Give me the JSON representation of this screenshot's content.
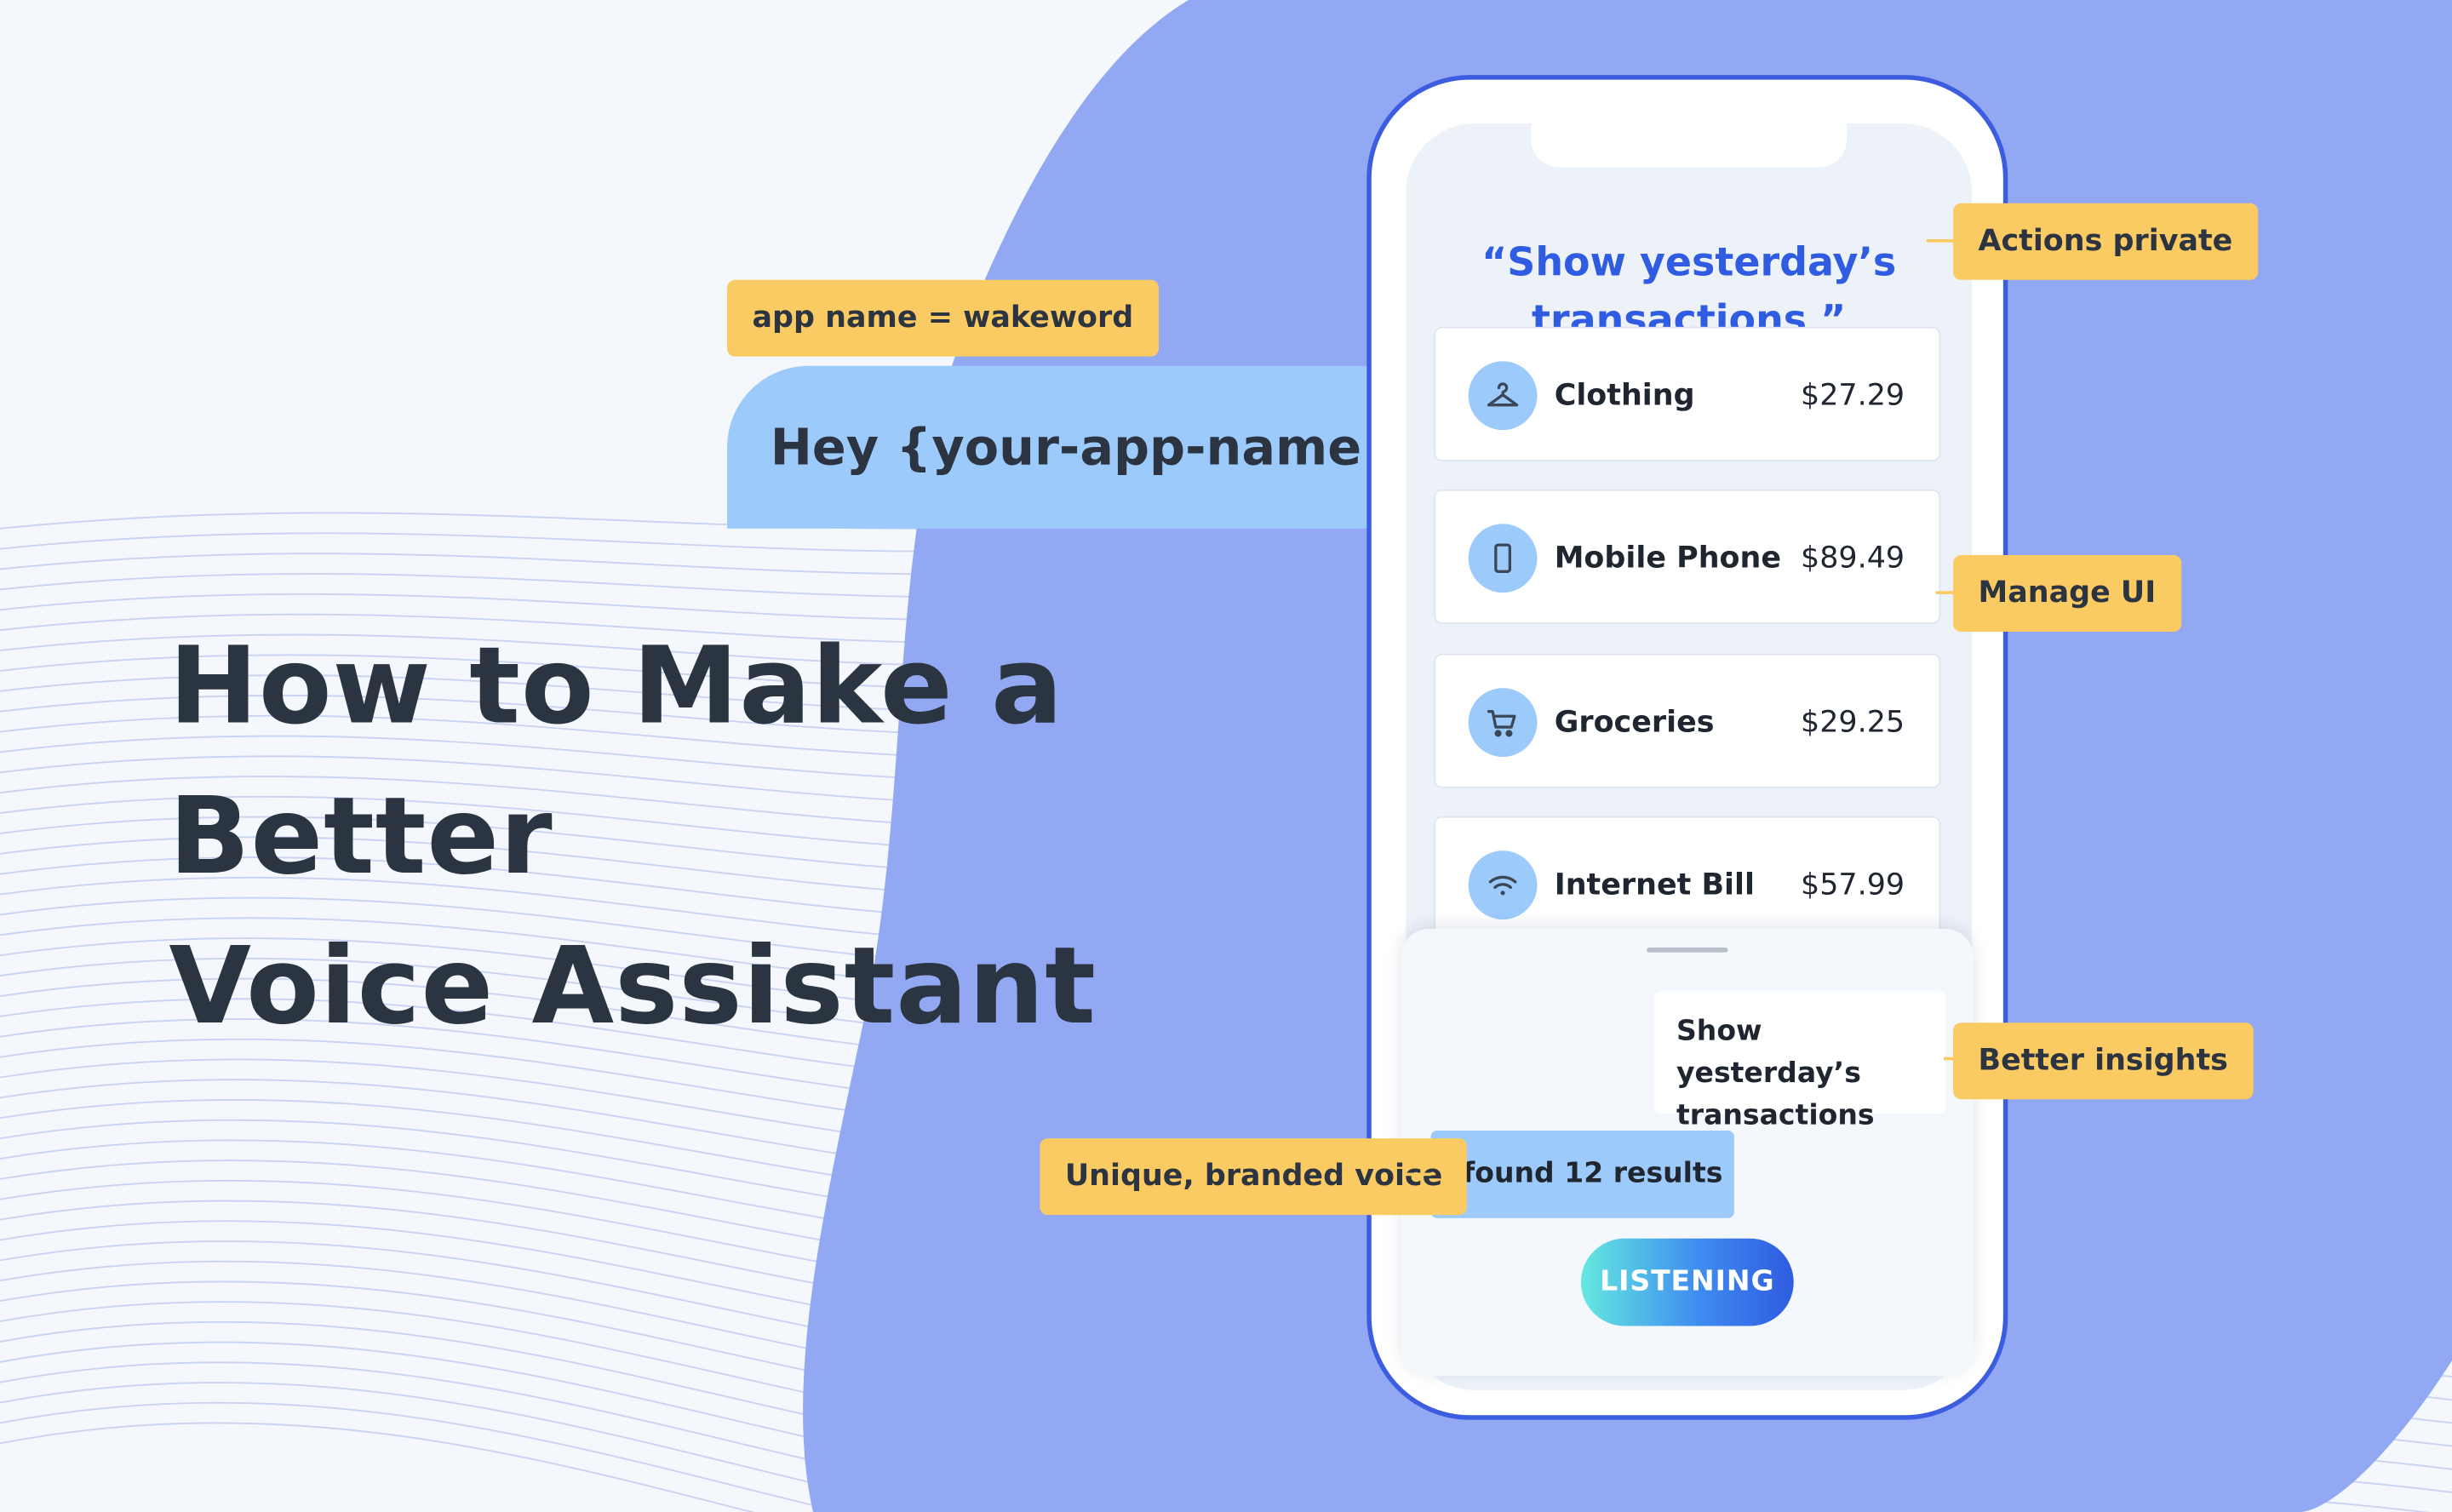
{
  "headline": {
    "line1": "How to Make a Better",
    "line2": "Voice Assistant"
  },
  "wakeword_tag": "app name = wakeword",
  "hey_bubble": "Hey {your-app-name}",
  "phone": {
    "query_line1": "“Show yesterday’s",
    "query_line2": "transactions ”",
    "transactions": [
      {
        "name": "Clothing",
        "amount": "$27.29",
        "icon": "hanger-icon"
      },
      {
        "name": "Mobile Phone",
        "amount": "$89.49",
        "icon": "mobile-phone-icon"
      },
      {
        "name": "Groceries",
        "amount": "$29.25",
        "icon": "cart-icon"
      },
      {
        "name": "Internet Bill",
        "amount": "$57.99",
        "icon": "wifi-icon"
      }
    ]
  },
  "assistant_sheet": {
    "user_message_line1": "Show yesterday’s",
    "user_message_line2": "transactions",
    "assistant_reply": "I found 12 results",
    "listen_button": "LISTENING"
  },
  "feature_tags": {
    "actions_private": "Actions private",
    "manage_ui": "Manage UI",
    "better_insights": "Better insights",
    "branded_voice": "Unique, branded voice"
  },
  "colors": {
    "background": "#f4f7fb",
    "blob": "#92a8f2",
    "accent_blue": "#2f5ce0",
    "tag_yellow": "#fbcb63",
    "bubble_blue": "#9ccbfb",
    "text_dark": "#2b3541"
  }
}
